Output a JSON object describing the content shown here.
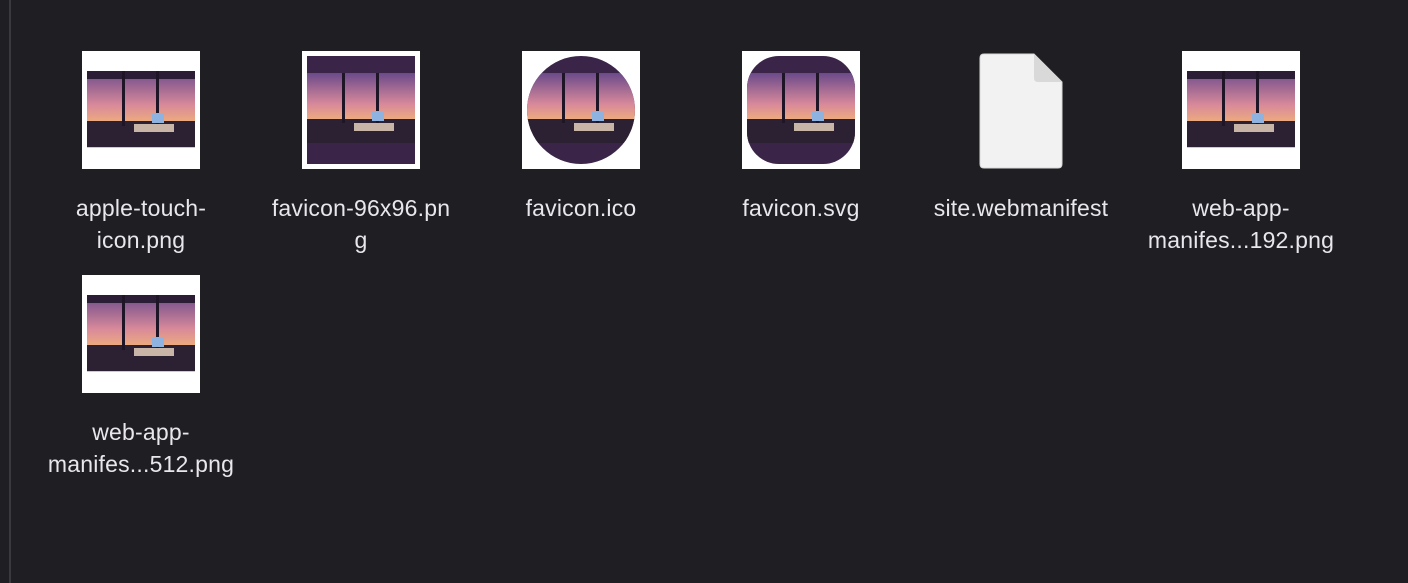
{
  "colors": {
    "background": "#1f1e22",
    "label_text": "#e8e7eb",
    "thumb_frame": "#ffffff",
    "icon_purple": "#3a2548"
  },
  "files": [
    {
      "name_lines": [
        "apple-touch-",
        "icon.png"
      ],
      "icon": "image-thumbnail-icon"
    },
    {
      "name_lines": [
        "favicon-96x96.pn",
        "g"
      ],
      "icon": "image-thumbnail-icon"
    },
    {
      "name_lines": [
        "favicon.ico"
      ],
      "icon": "image-thumbnail-icon"
    },
    {
      "name_lines": [
        "favicon.svg"
      ],
      "icon": "image-thumbnail-icon"
    },
    {
      "name_lines": [
        "site.webmanifest"
      ],
      "icon": "document-icon"
    },
    {
      "name_lines": [
        "web-app-",
        "manifes...192.png"
      ],
      "icon": "image-thumbnail-icon"
    },
    {
      "name_lines": [
        "web-app-",
        "manifes...512.png"
      ],
      "icon": "image-thumbnail-icon"
    }
  ]
}
